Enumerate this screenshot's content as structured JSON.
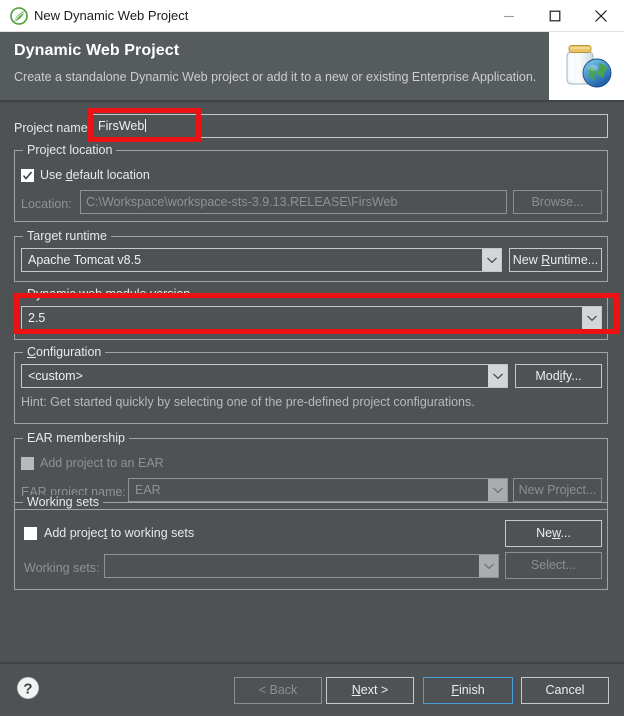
{
  "window": {
    "title": "New Dynamic Web Project",
    "app_icon": "spring-leaf-icon",
    "controls": {
      "minimize": "minimize-icon",
      "maximize": "maximize-icon",
      "close": "close-icon"
    }
  },
  "header": {
    "title": "Dynamic Web Project",
    "subtitle": "Create a standalone Dynamic Web project or add it to a new or existing Enterprise Application.",
    "banner_icon": "web-archive-globe-icon"
  },
  "form": {
    "project_name": {
      "label": "Project name:",
      "value": "FirsWeb"
    },
    "project_location": {
      "legend": "Project location",
      "use_default_label": "Use default location",
      "use_default_checked": true,
      "location_label": "Location:",
      "location_value": "C:\\Workspace\\workspace-sts-3.9.13.RELEASE\\FirsWeb",
      "browse_label": "Browse..."
    },
    "target_runtime": {
      "legend": "Target runtime",
      "value": "Apache Tomcat v8.5",
      "new_runtime_label": "New Runtime..."
    },
    "dynamic_web_module_version": {
      "legend": "Dynamic web module version",
      "value": "2.5"
    },
    "configuration": {
      "legend": "Configuration",
      "value": "<custom>",
      "modify_label": "Modify...",
      "hint": "Hint: Get started quickly by selecting one of the pre-defined project configurations."
    },
    "ear_membership": {
      "legend": "EAR membership",
      "add_to_ear_label": "Add project to an EAR",
      "add_to_ear_checked": false,
      "ear_project_name_label": "EAR project name:",
      "ear_project_name_value": "EAR",
      "new_project_label": "New Project..."
    },
    "working_sets": {
      "legend": "Working sets",
      "add_to_working_sets_label": "Add project to working sets",
      "add_to_working_sets_checked": false,
      "working_sets_label": "Working sets:",
      "working_sets_value": "",
      "new_label": "New...",
      "select_label": "Select..."
    }
  },
  "footer": {
    "help_icon": "help-question-icon",
    "back_label": "< Back",
    "next_label": "Next >",
    "finish_label": "Finish",
    "cancel_label": "Cancel"
  },
  "annotations": {
    "color": "#ee1111",
    "boxes": [
      {
        "name": "project-name-highlight"
      },
      {
        "name": "dynamic-web-module-version-highlight"
      }
    ]
  }
}
